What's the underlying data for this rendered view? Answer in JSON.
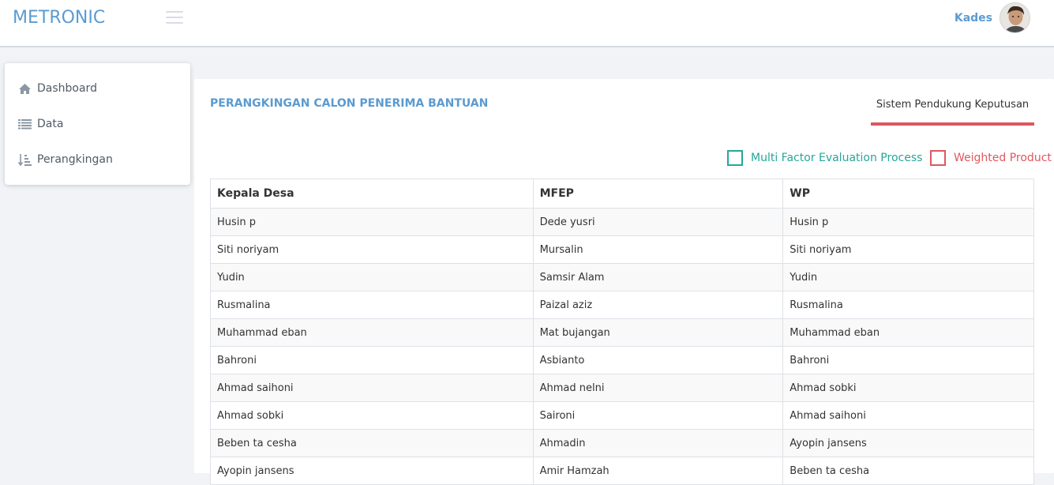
{
  "header": {
    "logo": "METRONIC",
    "user_name": "Kades"
  },
  "sidebar": {
    "items": [
      {
        "label": "Dashboard",
        "icon": "home-icon"
      },
      {
        "label": "Data",
        "icon": "list-icon"
      },
      {
        "label": "Perangkingan",
        "icon": "sort-icon"
      }
    ]
  },
  "main": {
    "title": "PERANGKINGAN CALON PENERIMA BANTUAN",
    "tab_label": "Sistem Pendukung Keputusan",
    "legend": [
      {
        "label": "Multi Factor Evaluation Process",
        "color": "#26a69a"
      },
      {
        "label": "Weighted Product",
        "color": "#e0575f"
      }
    ],
    "table": {
      "headers": [
        "Kepala Desa",
        "MFEP",
        "WP"
      ],
      "rows": [
        [
          "Husin p",
          "Dede yusri",
          "Husin p"
        ],
        [
          "Siti noriyam",
          "Mursalin",
          "Siti noriyam"
        ],
        [
          "Yudin",
          "Samsir Alam",
          "Yudin"
        ],
        [
          "Rusmalina",
          "Paizal aziz",
          "Rusmalina"
        ],
        [
          "Muhammad eban",
          "Mat bujangan",
          "Muhammad eban"
        ],
        [
          "Bahroni",
          "Asbianto",
          "Bahroni"
        ],
        [
          "Ahmad saihoni",
          "Ahmad nelni",
          "Ahmad sobki"
        ],
        [
          "Ahmad sobki",
          "Saironi",
          "Ahmad saihoni"
        ],
        [
          "Beben ta cesha",
          "Ahmadin",
          "Ayopin jansens"
        ],
        [
          "Ayopin jansens",
          "Amir Hamzah",
          "Beben ta cesha"
        ]
      ]
    }
  },
  "colors": {
    "accent": "#5b9bd1",
    "tab_underline": "#e0575f"
  }
}
